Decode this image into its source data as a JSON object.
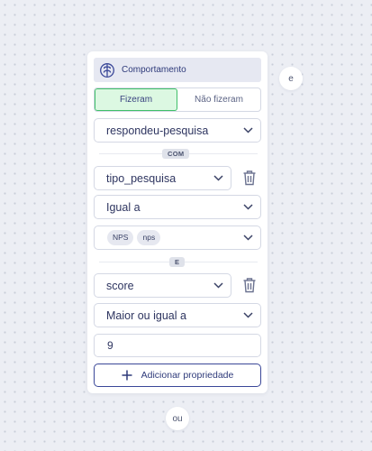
{
  "group": {
    "header": {
      "icon": "brain-icon",
      "title": "Comportamento"
    },
    "tabs": [
      {
        "label": "Fizeram",
        "active": true
      },
      {
        "label": "Não fizeram",
        "active": false
      }
    ],
    "event_select": {
      "value": "respondeu-pesquisa"
    },
    "with_label": "COM",
    "property_1": {
      "name": "tipo_pesquisa",
      "operator": "Igual a",
      "values": [
        "NPS",
        "nps"
      ]
    },
    "and_label": "E",
    "property_2": {
      "name": "score",
      "operator": "Maior ou igual a",
      "value": "9"
    },
    "add_property_label": "Adicionar propriedade"
  },
  "connectors": {
    "and_label": "e",
    "or_label": "ou"
  },
  "colors": {
    "accent": "#2e3a7a",
    "active_bg": "#dcf8e2",
    "active_border": "#3fbf69"
  }
}
